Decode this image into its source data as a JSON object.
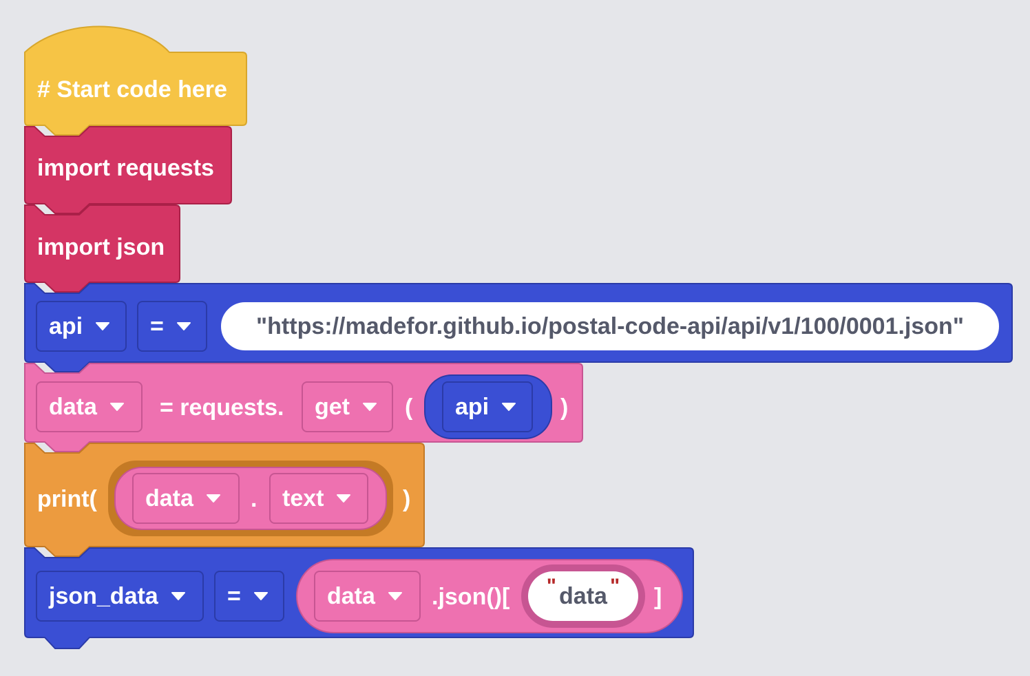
{
  "blocks": {
    "start": {
      "text": "# Start code here",
      "color": "#f6c445"
    },
    "import_requests": {
      "text": "import requests",
      "color": "#d43564"
    },
    "import_json": {
      "text": "import json",
      "color": "#d43564"
    },
    "assign_api": {
      "color": "#3a4fd4",
      "var": "api",
      "op": "=",
      "value": "\"https://madefor.github.io/postal-code-api/api/v1/100/0001.json\""
    },
    "assign_data": {
      "color": "#ee71b0",
      "var": "data",
      "middle": "= requests.",
      "method": "get",
      "open": "(",
      "arg": "api",
      "close": ")"
    },
    "print": {
      "color": "#ec9b3f",
      "prefix": "print(",
      "obj": "data",
      "dot": ".",
      "attr": "text",
      "close": ")"
    },
    "assign_json": {
      "color": "#3a4fd4",
      "var": "json_data",
      "op": "=",
      "obj": "data",
      "call": ".json()[",
      "quote": "\"",
      "key": "data",
      "close": "]"
    }
  },
  "icons": {
    "dropdown": "caret-down-icon"
  }
}
